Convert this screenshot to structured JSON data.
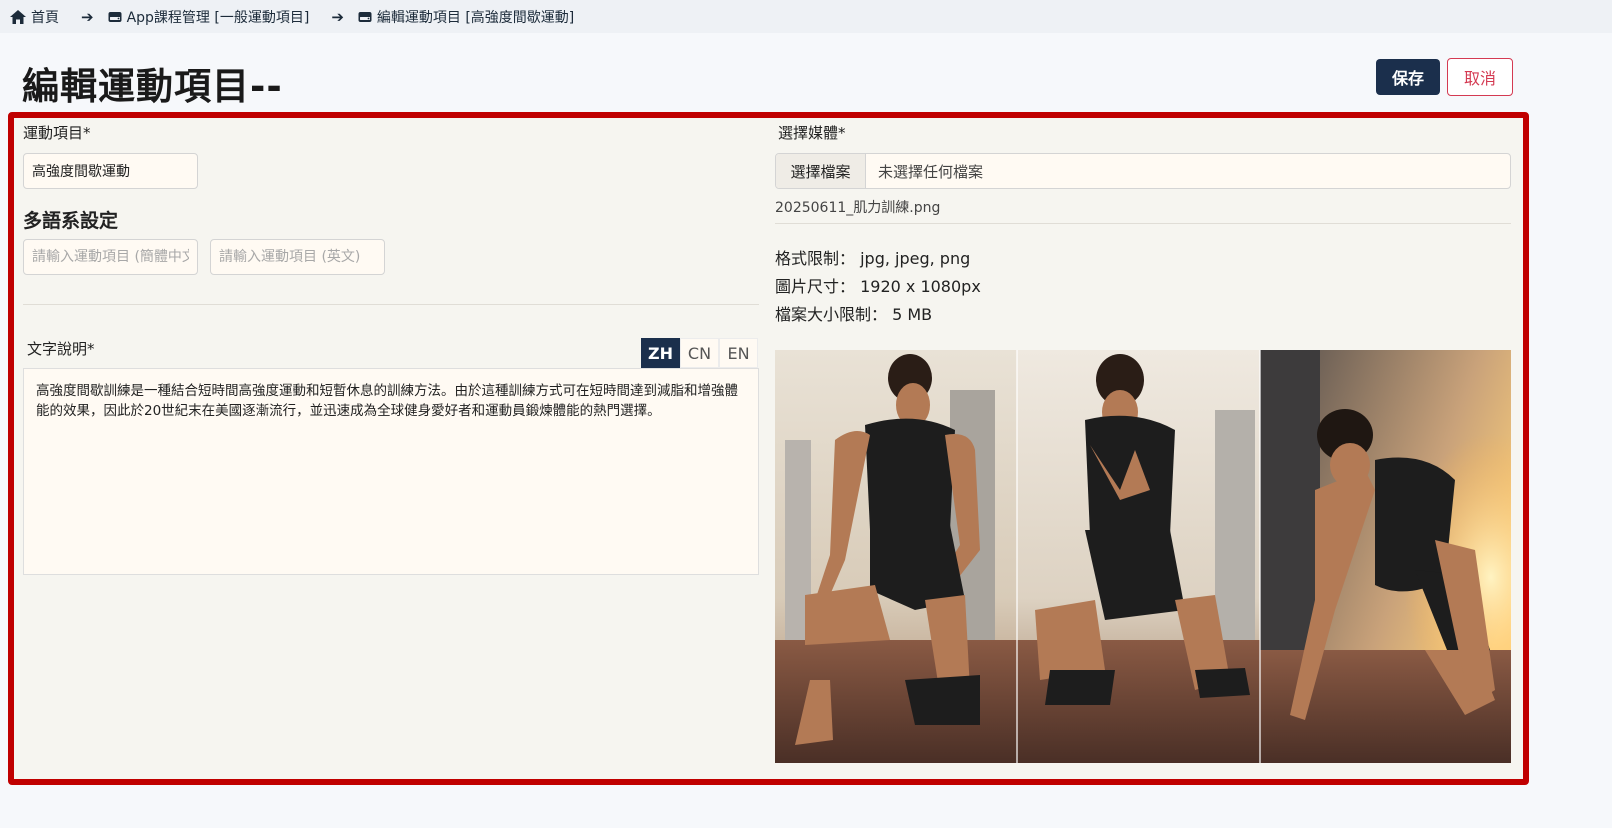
{
  "breadcrumb": {
    "home": "首頁",
    "course_mgmt": "App課程管理 [一般運動項目]",
    "current": "編輯運動項目 [高強度間歇運動]"
  },
  "page": {
    "title": "編輯運動項目--",
    "save_label": "保存",
    "cancel_label": "取消"
  },
  "form": {
    "exercise_label": "運動項目*",
    "exercise_value": "高強度間歇運動",
    "multilang_title": "多語系設定",
    "cn_placeholder": "請輸入運動項目 (簡體中文)",
    "en_placeholder": "請輸入運動項目 (英文)",
    "description_label": "文字說明*",
    "lang_tabs": [
      "ZH",
      "CN",
      "EN"
    ],
    "active_lang": "ZH",
    "description_text": "高強度間歇訓練是一種結合短時間高強度運動和短暫休息的訓練方法。由於這種訓練方式可在短時間達到減脂和增強體能的效果，因此於20世紀末在美國逐漸流行，並迅速成為全球健身愛好者和運動員鍛煉體能的熱門選擇。"
  },
  "media": {
    "label": "選擇媒體*",
    "choose_button": "選擇檔案",
    "no_file": "未選擇任何檔案",
    "current_file": "20250611_肌力訓練.png",
    "format_limit": "格式限制： jpg, jpeg, png",
    "image_size": "圖片尺寸： 1920 x 1080px",
    "size_limit": "檔案大小限制： 5 MB"
  },
  "colors": {
    "primary": "#1b2f4c",
    "danger": "#d43a52",
    "highlight_border": "#c00000"
  }
}
